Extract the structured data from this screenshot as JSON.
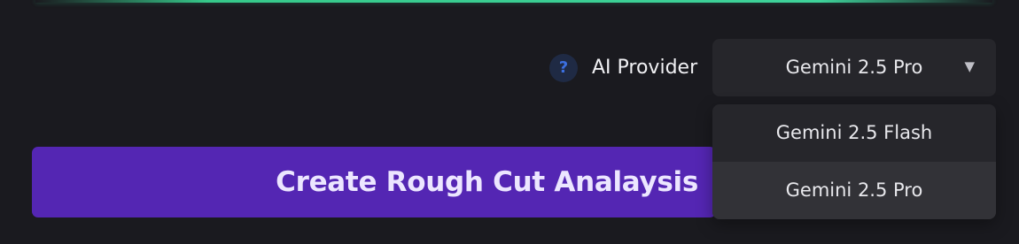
{
  "provider": {
    "help_glyph": "?",
    "label": "AI Provider",
    "selected": "Gemini 2.5 Pro",
    "chevron": "▼",
    "options": [
      {
        "label": "Gemini 2.5 Flash",
        "highlighted": false
      },
      {
        "label": "Gemini 2.5 Pro",
        "highlighted": true
      }
    ]
  },
  "action": {
    "create_label": "Create Rough Cut Analaysis"
  },
  "icons": {
    "help": "question-circle-icon",
    "chevron": "chevron-down-icon"
  },
  "colors": {
    "background": "#1a1a1f",
    "accent_line": "#36c98a",
    "button": "#5426b3",
    "help_icon": "#3c6fe0",
    "select_bg": "#26262b",
    "option_highlight": "#323237"
  }
}
